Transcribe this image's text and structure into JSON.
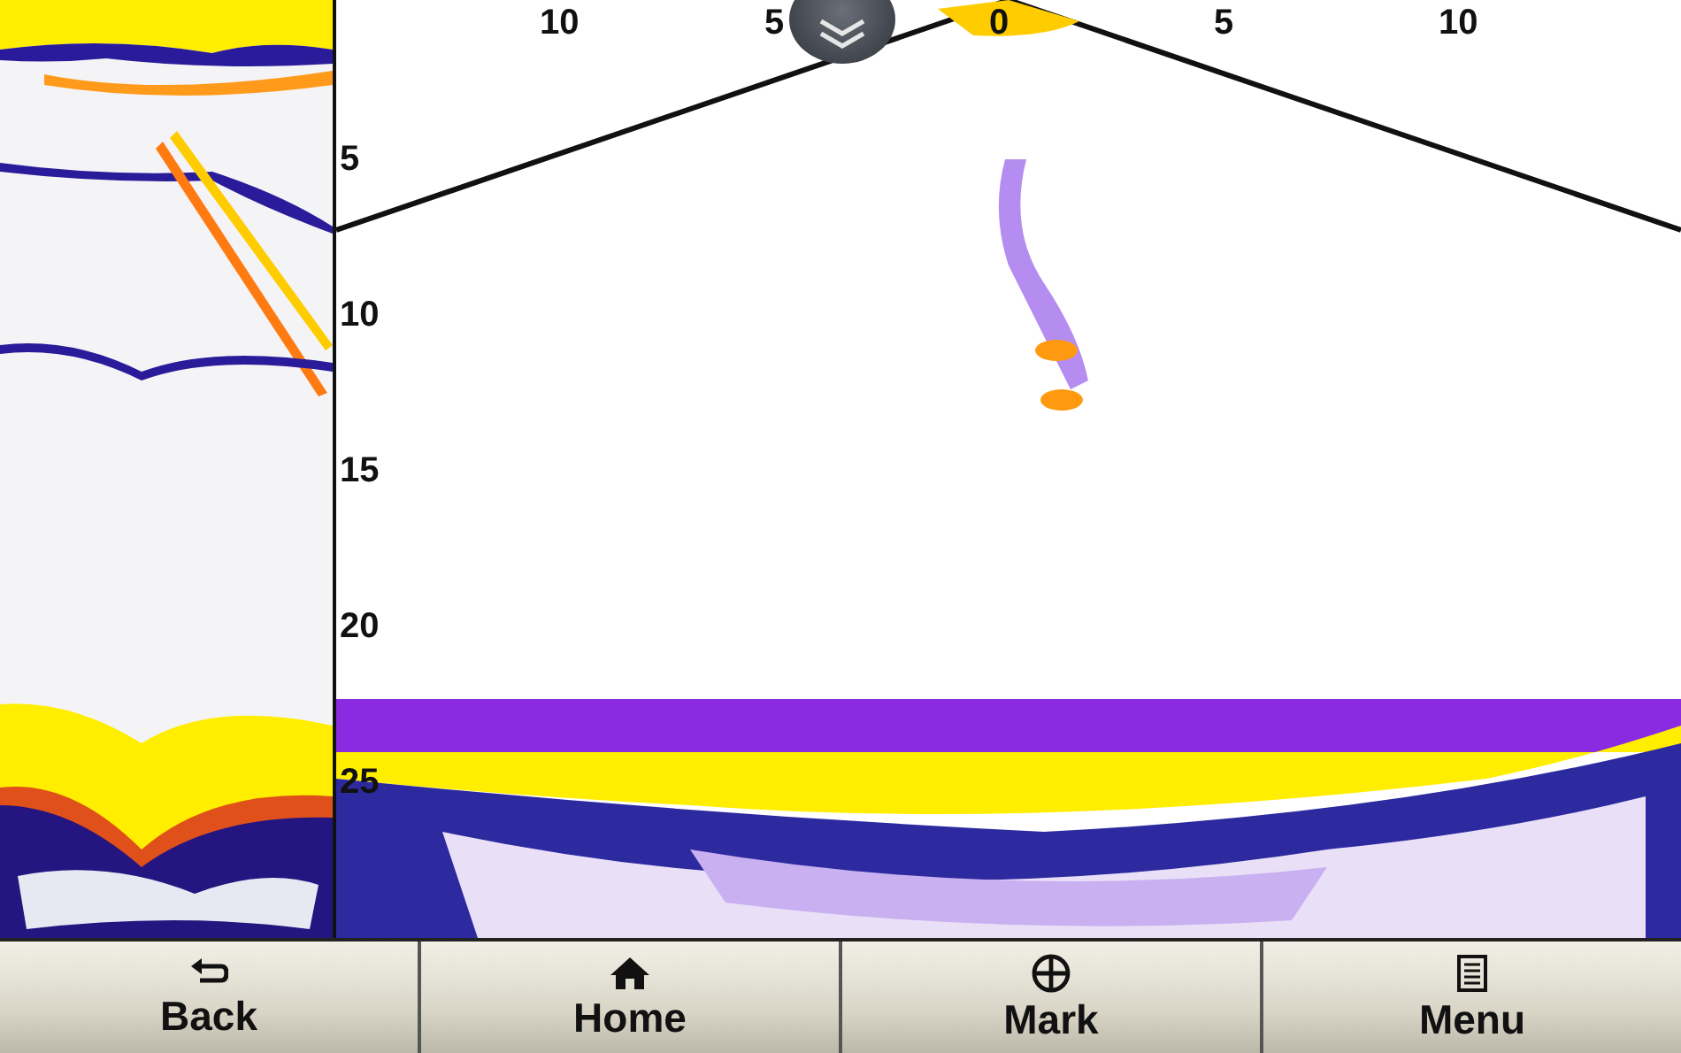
{
  "range_scale": [
    "10",
    "5",
    "0",
    "5",
    "10"
  ],
  "depth_scale": [
    "5",
    "10",
    "15",
    "20",
    "25"
  ],
  "buttons": [
    {
      "label": "Back",
      "kind": "back"
    },
    {
      "label": "Home",
      "kind": "home"
    },
    {
      "label": "Mark",
      "kind": "mark"
    },
    {
      "label": "Menu",
      "kind": "menu"
    }
  ]
}
